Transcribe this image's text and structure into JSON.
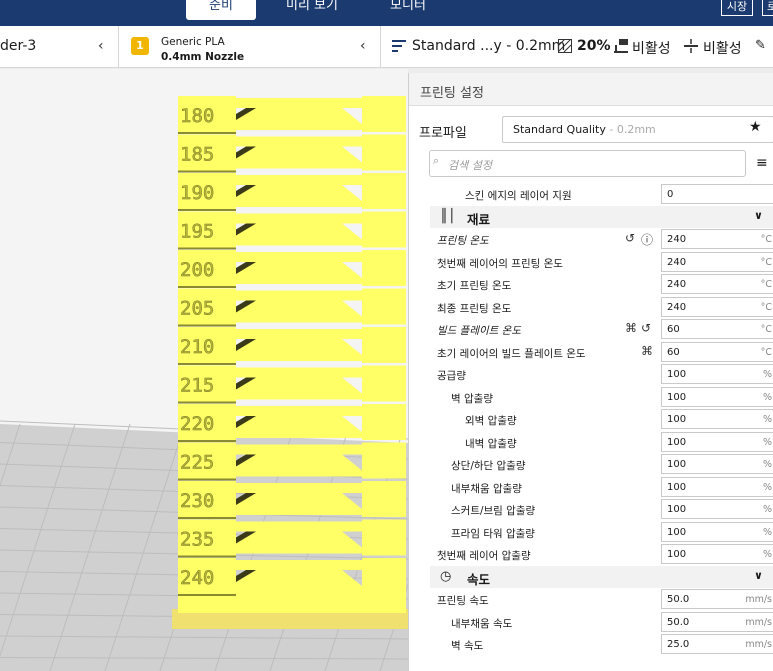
{
  "stages": {
    "prepare": "준비",
    "preview": "미리 보기",
    "monitor": "모니터"
  },
  "topbar": {
    "market": "시장",
    "extra": "로"
  },
  "toolbar": {
    "printer_name": "der-3",
    "material_badge": "1",
    "material_name": "Generic PLA",
    "nozzle": "0.4mm Nozzle",
    "profile_summary": "Standard ...y - 0.2mm",
    "infill_icon": "infill-icon",
    "infill": "20%",
    "support_label": "비활성",
    "adhesion_label": "비활성"
  },
  "model": {
    "tower_labels": [
      "180",
      "185",
      "190",
      "195",
      "200",
      "205",
      "210",
      "215",
      "220",
      "225",
      "230",
      "235",
      "240"
    ],
    "color": "#ffff66"
  },
  "panel": {
    "title": "프린팅 설정",
    "profile_label": "프로파일",
    "profile_value": "Standard Quality",
    "profile_suffix": " - 0.2mm",
    "search_placeholder": "검색 설정"
  },
  "settings": [
    {
      "label": "스킨 에지의 레이어 지원",
      "value": "0",
      "unit": "",
      "indent": 2
    },
    {
      "category": true,
      "label": "재료",
      "icon": "material-icon"
    },
    {
      "label": "프린팅 온도",
      "value": "240",
      "unit": "°C",
      "indent": 0,
      "italic": true,
      "icons": [
        "reset-icon",
        "info-icon"
      ]
    },
    {
      "label": "첫번째 레이어의 프린팅 온도",
      "value": "240",
      "unit": "°C",
      "indent": 0
    },
    {
      "label": "초기 프린팅 온도",
      "value": "240",
      "unit": "°C",
      "indent": 0
    },
    {
      "label": "최종 프린팅 온도",
      "value": "240",
      "unit": "°C",
      "indent": 0
    },
    {
      "label": "빌드 플레이트 온도",
      "value": "60",
      "unit": "°C",
      "indent": 0,
      "italic": true,
      "icons": [
        "link-icon",
        "reset-icon"
      ]
    },
    {
      "label": "초기 레이어의 빌드 플레이트 온도",
      "value": "60",
      "unit": "°C",
      "indent": 0,
      "icons": [
        "link-icon"
      ]
    },
    {
      "label": "공급량",
      "value": "100",
      "unit": "%",
      "indent": 0
    },
    {
      "label": "벽 압출량",
      "value": "100",
      "unit": "%",
      "indent": 1
    },
    {
      "label": "외벽 압출량",
      "value": "100",
      "unit": "%",
      "indent": 2
    },
    {
      "label": "내벽 압출량",
      "value": "100",
      "unit": "%",
      "indent": 2
    },
    {
      "label": "상단/하단 압출량",
      "value": "100",
      "unit": "%",
      "indent": 1
    },
    {
      "label": "내부채움 압출량",
      "value": "100",
      "unit": "%",
      "indent": 1
    },
    {
      "label": "스커트/브림 압출량",
      "value": "100",
      "unit": "%",
      "indent": 1
    },
    {
      "label": "프라임 타워 압출량",
      "value": "100",
      "unit": "%",
      "indent": 1
    },
    {
      "label": "첫번째 레이어 압출량",
      "value": "100",
      "unit": "%",
      "indent": 0
    },
    {
      "category": true,
      "label": "속도",
      "icon": "speed-icon"
    },
    {
      "label": "프린팅 속도",
      "value": "50.0",
      "unit": "mm/s",
      "indent": 0
    },
    {
      "label": "내부채움 속도",
      "value": "50.0",
      "unit": "mm/s",
      "indent": 1
    },
    {
      "label": "벽 속도",
      "value": "25.0",
      "unit": "mm/s",
      "indent": 1
    }
  ]
}
